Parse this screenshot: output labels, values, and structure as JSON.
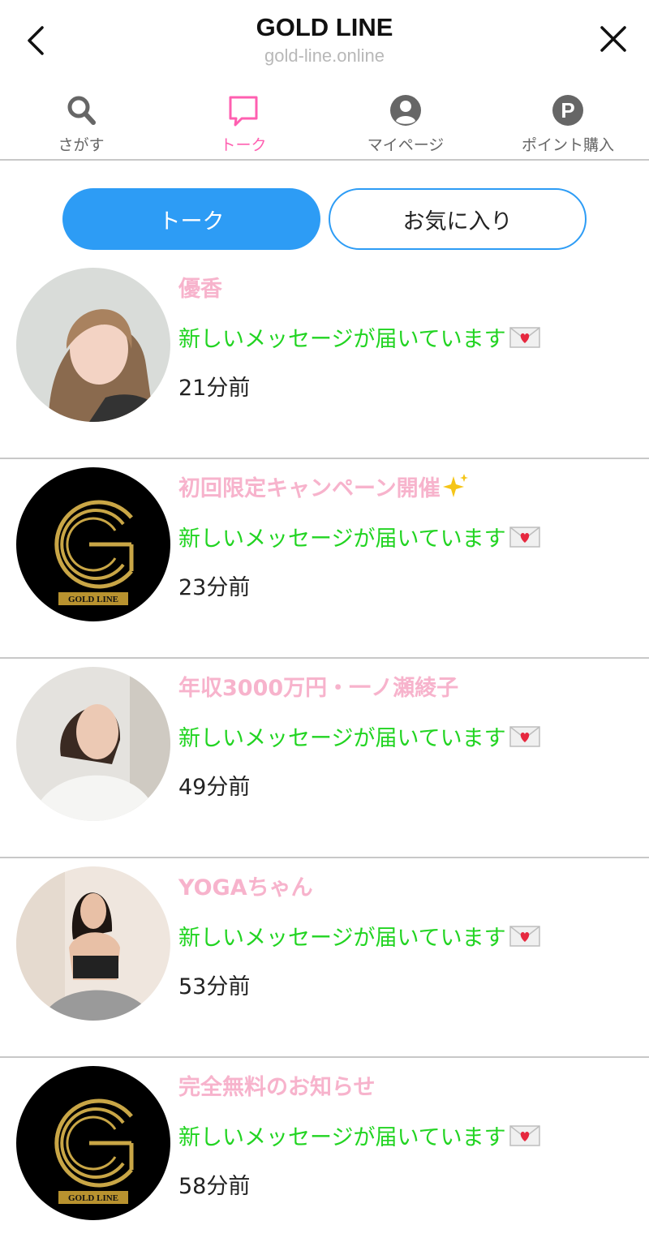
{
  "header": {
    "title": "GOLD LINE",
    "domain": "gold-line.online"
  },
  "nav": [
    {
      "label": "さがす",
      "icon": "search-icon"
    },
    {
      "label": "トーク",
      "icon": "chat-bubble-icon",
      "active": true
    },
    {
      "label": "マイページ",
      "icon": "user-icon"
    },
    {
      "label": "ポイント購入",
      "icon": "points-icon"
    }
  ],
  "segments": {
    "talk": "トーク",
    "favorites": "お気に入り"
  },
  "colors": {
    "accent_blue": "#2d9cf5",
    "active_pink": "#ff5fb0",
    "name_pink": "#f7b3cc",
    "message_green": "#22d422"
  },
  "logo_text": "GOLD LINE",
  "messages": [
    {
      "name": "優香",
      "message": "新しいメッセージが届いています",
      "time": "21分前",
      "avatar": "photo-avatar"
    },
    {
      "name": "初回限定キャンペーン開催",
      "message": "新しいメッセージが届いています",
      "time": "23分前",
      "avatar": "gold-line-logo-avatar"
    },
    {
      "name": "年収3000万円・一ノ瀬綾子",
      "message": "新しいメッセージが届いています",
      "time": "49分前",
      "avatar": "photo-avatar"
    },
    {
      "name": "YOGAちゃん",
      "message": "新しいメッセージが届いています",
      "time": "53分前",
      "avatar": "photo-avatar"
    },
    {
      "name": "完全無料のお知らせ",
      "message": "新しいメッセージが届いています",
      "time": "58分前",
      "avatar": "gold-line-logo-avatar"
    }
  ]
}
